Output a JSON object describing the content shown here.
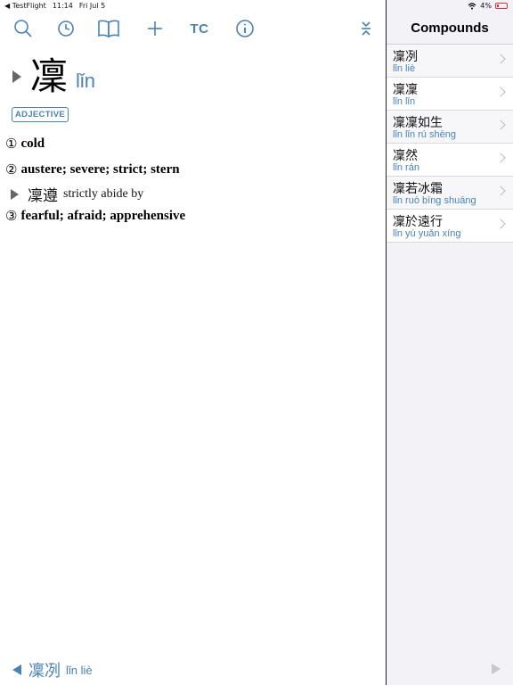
{
  "status_bar": {
    "back_app": "◀ TestFlight",
    "time": "11:14",
    "date": "Fri Jul 5",
    "battery": "4%"
  },
  "toolbar": {
    "tc_label": "TC"
  },
  "entry": {
    "hanzi": "凜",
    "pinyin": "lǐn",
    "part_of_speech": "ADJECTIVE",
    "definitions": [
      {
        "num": "①",
        "text": "cold"
      },
      {
        "num": "②",
        "text": "austere; severe; strict; stern"
      },
      {
        "num": "③",
        "text": "fearful; afraid; apprehensive"
      }
    ],
    "example": {
      "hanzi": "凜遵",
      "gloss": "strictly abide by"
    }
  },
  "bottom_nav": {
    "prev_hanzi": "凜冽",
    "prev_pinyin": "lǐn liè"
  },
  "sidebar": {
    "title": "Compounds",
    "items": [
      {
        "hanzi": "凜冽",
        "pinyin": "lǐn liè"
      },
      {
        "hanzi": "凜凜",
        "pinyin": "lǐn lǐn"
      },
      {
        "hanzi": "凜凜如生",
        "pinyin": "lǐn lǐn rú shēng"
      },
      {
        "hanzi": "凜然",
        "pinyin": "lǐn rán"
      },
      {
        "hanzi": "凜若冰霜",
        "pinyin": "lǐn ruò bīng shuāng"
      },
      {
        "hanzi": "凜於遠行",
        "pinyin": "lǐn yú yuǎn xíng"
      }
    ]
  },
  "colors": {
    "accent": "#4a82b3",
    "sidebar_bg": "#f2f2f7"
  },
  "icons": [
    "search-icon",
    "history-icon",
    "book-icon",
    "add-icon",
    "info-icon",
    "collapse-icon"
  ]
}
